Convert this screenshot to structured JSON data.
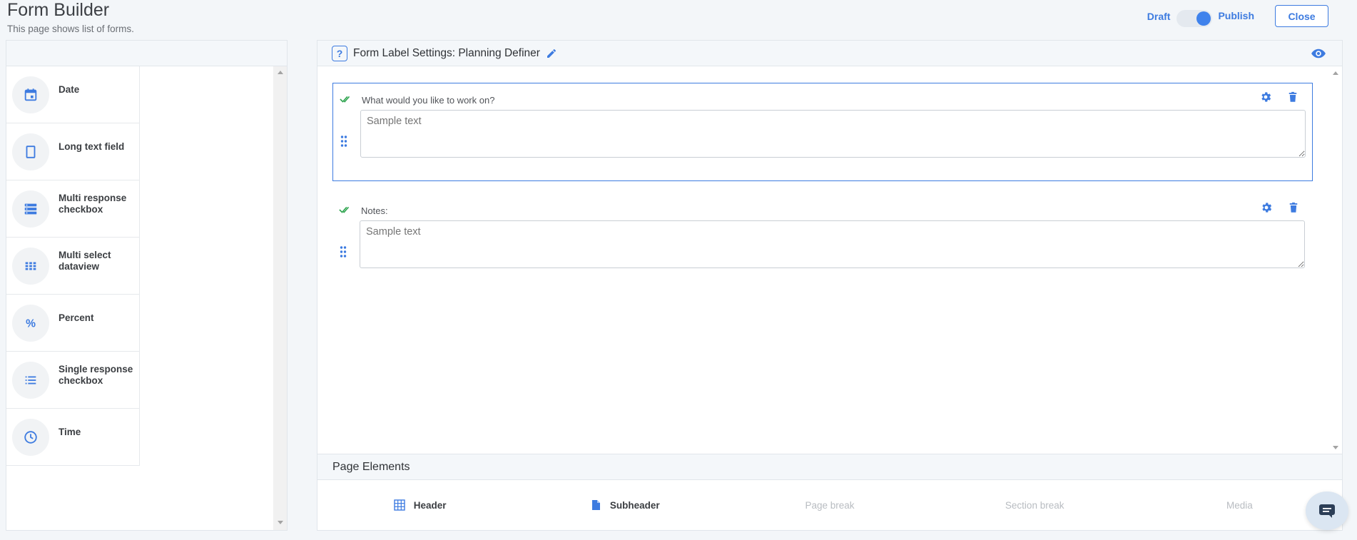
{
  "header": {
    "title": "Form Builder",
    "subtitle": "This page shows list of forms."
  },
  "top_actions": {
    "draft_label": "Draft",
    "publish_label": "Publish",
    "close_label": "Close",
    "publish_toggle_on": true
  },
  "palette": {
    "items": [
      {
        "label": "Date",
        "icon": "calendar-icon"
      },
      {
        "label": "Long text field",
        "icon": "textbox-icon"
      },
      {
        "label": "Multi response checkbox",
        "icon": "stacked-list-icon"
      },
      {
        "label": "Multi select dataview",
        "icon": "grid-icon"
      },
      {
        "label": "Percent",
        "icon": "percent-icon"
      },
      {
        "label": "Single response checkbox",
        "icon": "bullet-list-icon"
      },
      {
        "label": "Time",
        "icon": "clock-icon"
      }
    ]
  },
  "form": {
    "title": "Form Label Settings: Planning Definer",
    "help_icon_text": "?",
    "fields": [
      {
        "label": "What would you like to work on?",
        "placeholder": "Sample text",
        "selected": true
      },
      {
        "label": "Notes:",
        "placeholder": "Sample text",
        "selected": false
      }
    ]
  },
  "page_elements": {
    "title": "Page Elements",
    "items": [
      {
        "label": "Header",
        "icon": "table-icon",
        "enabled": true
      },
      {
        "label": "Subheader",
        "icon": "document-icon",
        "enabled": true
      },
      {
        "label": "Page break",
        "icon": "",
        "enabled": false
      },
      {
        "label": "Section break",
        "icon": "",
        "enabled": false
      },
      {
        "label": "Media",
        "icon": "",
        "enabled": false
      }
    ]
  },
  "colors": {
    "accent": "#3d7be0",
    "check_green": "#2ea44f",
    "background": "#f3f6f9"
  }
}
